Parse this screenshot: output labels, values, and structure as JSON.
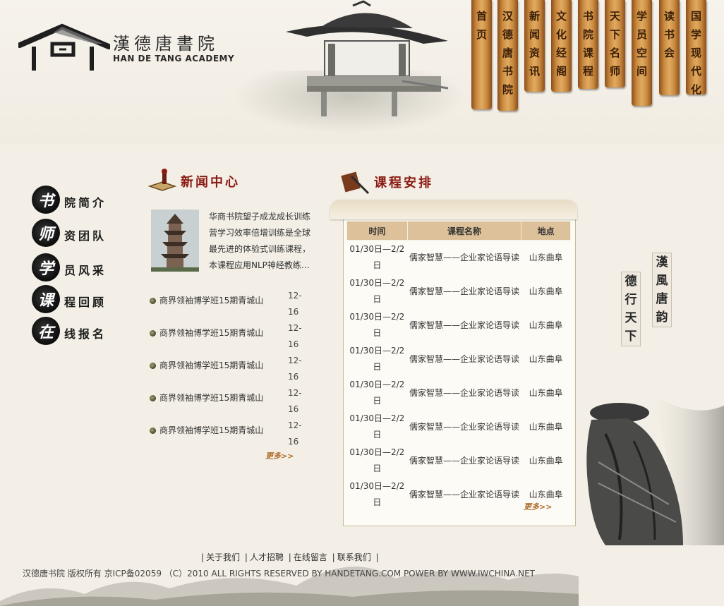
{
  "brand": {
    "name_cn": "漢德唐書院",
    "name_en": "HAN DE TANG ACADEMY"
  },
  "nav": [
    {
      "label": "首页"
    },
    {
      "label": "汉德唐书院"
    },
    {
      "label": "新闻资讯"
    },
    {
      "label": "文化经阁"
    },
    {
      "label": "书院课程"
    },
    {
      "label": "天下名师"
    },
    {
      "label": "学员空间"
    },
    {
      "label": "读书会"
    },
    {
      "label": "国学现代化"
    }
  ],
  "side_menu": [
    {
      "initial": "书",
      "rest": "院简介"
    },
    {
      "initial": "师",
      "rest": "资团队"
    },
    {
      "initial": "学",
      "rest": "员风采"
    },
    {
      "initial": "课",
      "rest": "程回顾"
    },
    {
      "initial": "在",
      "rest": "线报名"
    }
  ],
  "news": {
    "title": "新闻中心",
    "summary": "华商书院望子成龙成长训练营学习效率倍增训练是全球最先进的体验式训练课程，本课程应用NLP神经教练…",
    "items": [
      {
        "title": "商界领袖博学班15期青城山",
        "date": "12-16"
      },
      {
        "title": "商界领袖博学班15期青城山",
        "date": "12-16"
      },
      {
        "title": "商界领袖博学班15期青城山",
        "date": "12-16"
      },
      {
        "title": "商界领袖博学班15期青城山",
        "date": "12-16"
      },
      {
        "title": "商界领袖博学班15期青城山",
        "date": "12-16"
      }
    ],
    "more": "更多>>"
  },
  "schedule": {
    "title": "课程安排",
    "headers": [
      "时间",
      "课程名称",
      "地点"
    ],
    "rows": [
      {
        "time": "01/30日—2/2日",
        "name": "儒家智慧——企业家论语导读",
        "place": "山东曲阜"
      },
      {
        "time": "01/30日—2/2日",
        "name": "儒家智慧——企业家论语导读",
        "place": "山东曲阜"
      },
      {
        "time": "01/30日—2/2日",
        "name": "儒家智慧——企业家论语导读",
        "place": "山东曲阜"
      },
      {
        "time": "01/30日—2/2日",
        "name": "儒家智慧——企业家论语导读",
        "place": "山东曲阜"
      },
      {
        "time": "01/30日—2/2日",
        "name": "儒家智慧——企业家论语导读",
        "place": "山东曲阜"
      },
      {
        "time": "01/30日—2/2日",
        "name": "儒家智慧——企业家论语导读",
        "place": "山东曲阜"
      },
      {
        "time": "01/30日—2/2日",
        "name": "儒家智慧——企业家论语导读",
        "place": "山东曲阜"
      },
      {
        "time": "01/30日—2/2日",
        "name": "儒家智慧——企业家论语导读",
        "place": "山东曲阜"
      }
    ],
    "more": "更多>>"
  },
  "motto": {
    "left": "德行天下",
    "right": "漢風唐韵"
  },
  "footer": {
    "links": [
      "关于我们",
      "人才招聘",
      "在线留言",
      "联系我们"
    ],
    "copyright": "汉德唐书院 版权所有 京ICP备02059 （C）2010 ALL RIGHTS RESERVED BY HANDETANG.COM POWER BY WWW.IWCHINA.NET"
  },
  "colors": {
    "background": "#f3efe6",
    "title_red": "#8b1a12",
    "bamboo": "#c98a3f",
    "table_header": "#ddc19a",
    "more_link": "#b06d2c"
  }
}
